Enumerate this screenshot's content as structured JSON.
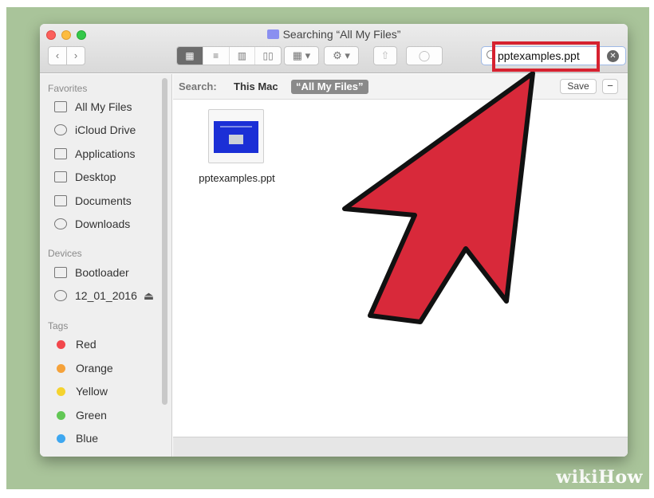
{
  "window": {
    "title": "Searching “All My Files”"
  },
  "toolbar": {
    "back_label": "‹",
    "forward_label": "›",
    "views": [
      "▦",
      "≡",
      "▥",
      "▯▯"
    ],
    "arrange_label": "▦ ▾",
    "action_label": "⚙ ▾",
    "share_label": "⇧",
    "tags_label": "◯"
  },
  "search": {
    "value": "pptexamples.ppt",
    "clear_label": "✕"
  },
  "sidebar": {
    "favorites_heading": "Favorites",
    "favorites": [
      {
        "label": "All My Files",
        "icon": "all-my-files-icon"
      },
      {
        "label": "iCloud Drive",
        "icon": "cloud-icon"
      },
      {
        "label": "Applications",
        "icon": "applications-icon"
      },
      {
        "label": "Desktop",
        "icon": "desktop-icon"
      },
      {
        "label": "Documents",
        "icon": "documents-icon"
      },
      {
        "label": "Downloads",
        "icon": "downloads-icon"
      }
    ],
    "devices_heading": "Devices",
    "devices": [
      {
        "label": "Bootloader",
        "icon": "disk-icon"
      },
      {
        "label": "12_01_2016",
        "icon": "disc-icon",
        "eject": "⏏"
      }
    ],
    "tags_heading": "Tags",
    "tags": [
      {
        "label": "Red",
        "color": "#f2474c"
      },
      {
        "label": "Orange",
        "color": "#f5a23a"
      },
      {
        "label": "Yellow",
        "color": "#f5d32e"
      },
      {
        "label": "Green",
        "color": "#62c755"
      },
      {
        "label": "Blue",
        "color": "#3ea7f0"
      }
    ]
  },
  "searchbar": {
    "label": "Search:",
    "scope_this_mac": "This Mac",
    "scope_all_files": "“All My Files”",
    "save_label": "Save",
    "minus_label": "−"
  },
  "results": [
    {
      "name": "pptexamples.ppt"
    }
  ],
  "watermark": {
    "wiki": "wiki",
    "how": "How"
  },
  "colors": {
    "highlight": "#d62230",
    "arrow_fill": "#d8293a",
    "background": "#a9c49a"
  }
}
